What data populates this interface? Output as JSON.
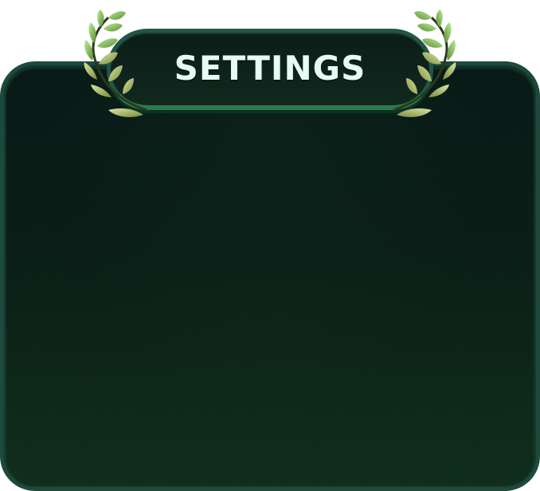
{
  "title": "SETTINGS",
  "colors": {
    "panel_border": "#1c4a3c",
    "panel_bg_top": "#031512",
    "panel_bg_bottom": "#0b2a16",
    "title_text": "#e6fbf3",
    "laurel_light": "#a6e08c",
    "laurel_dark": "#6f8f3a"
  },
  "icons": {
    "left_decoration": "laurel-branch-icon",
    "right_decoration": "laurel-branch-icon"
  }
}
